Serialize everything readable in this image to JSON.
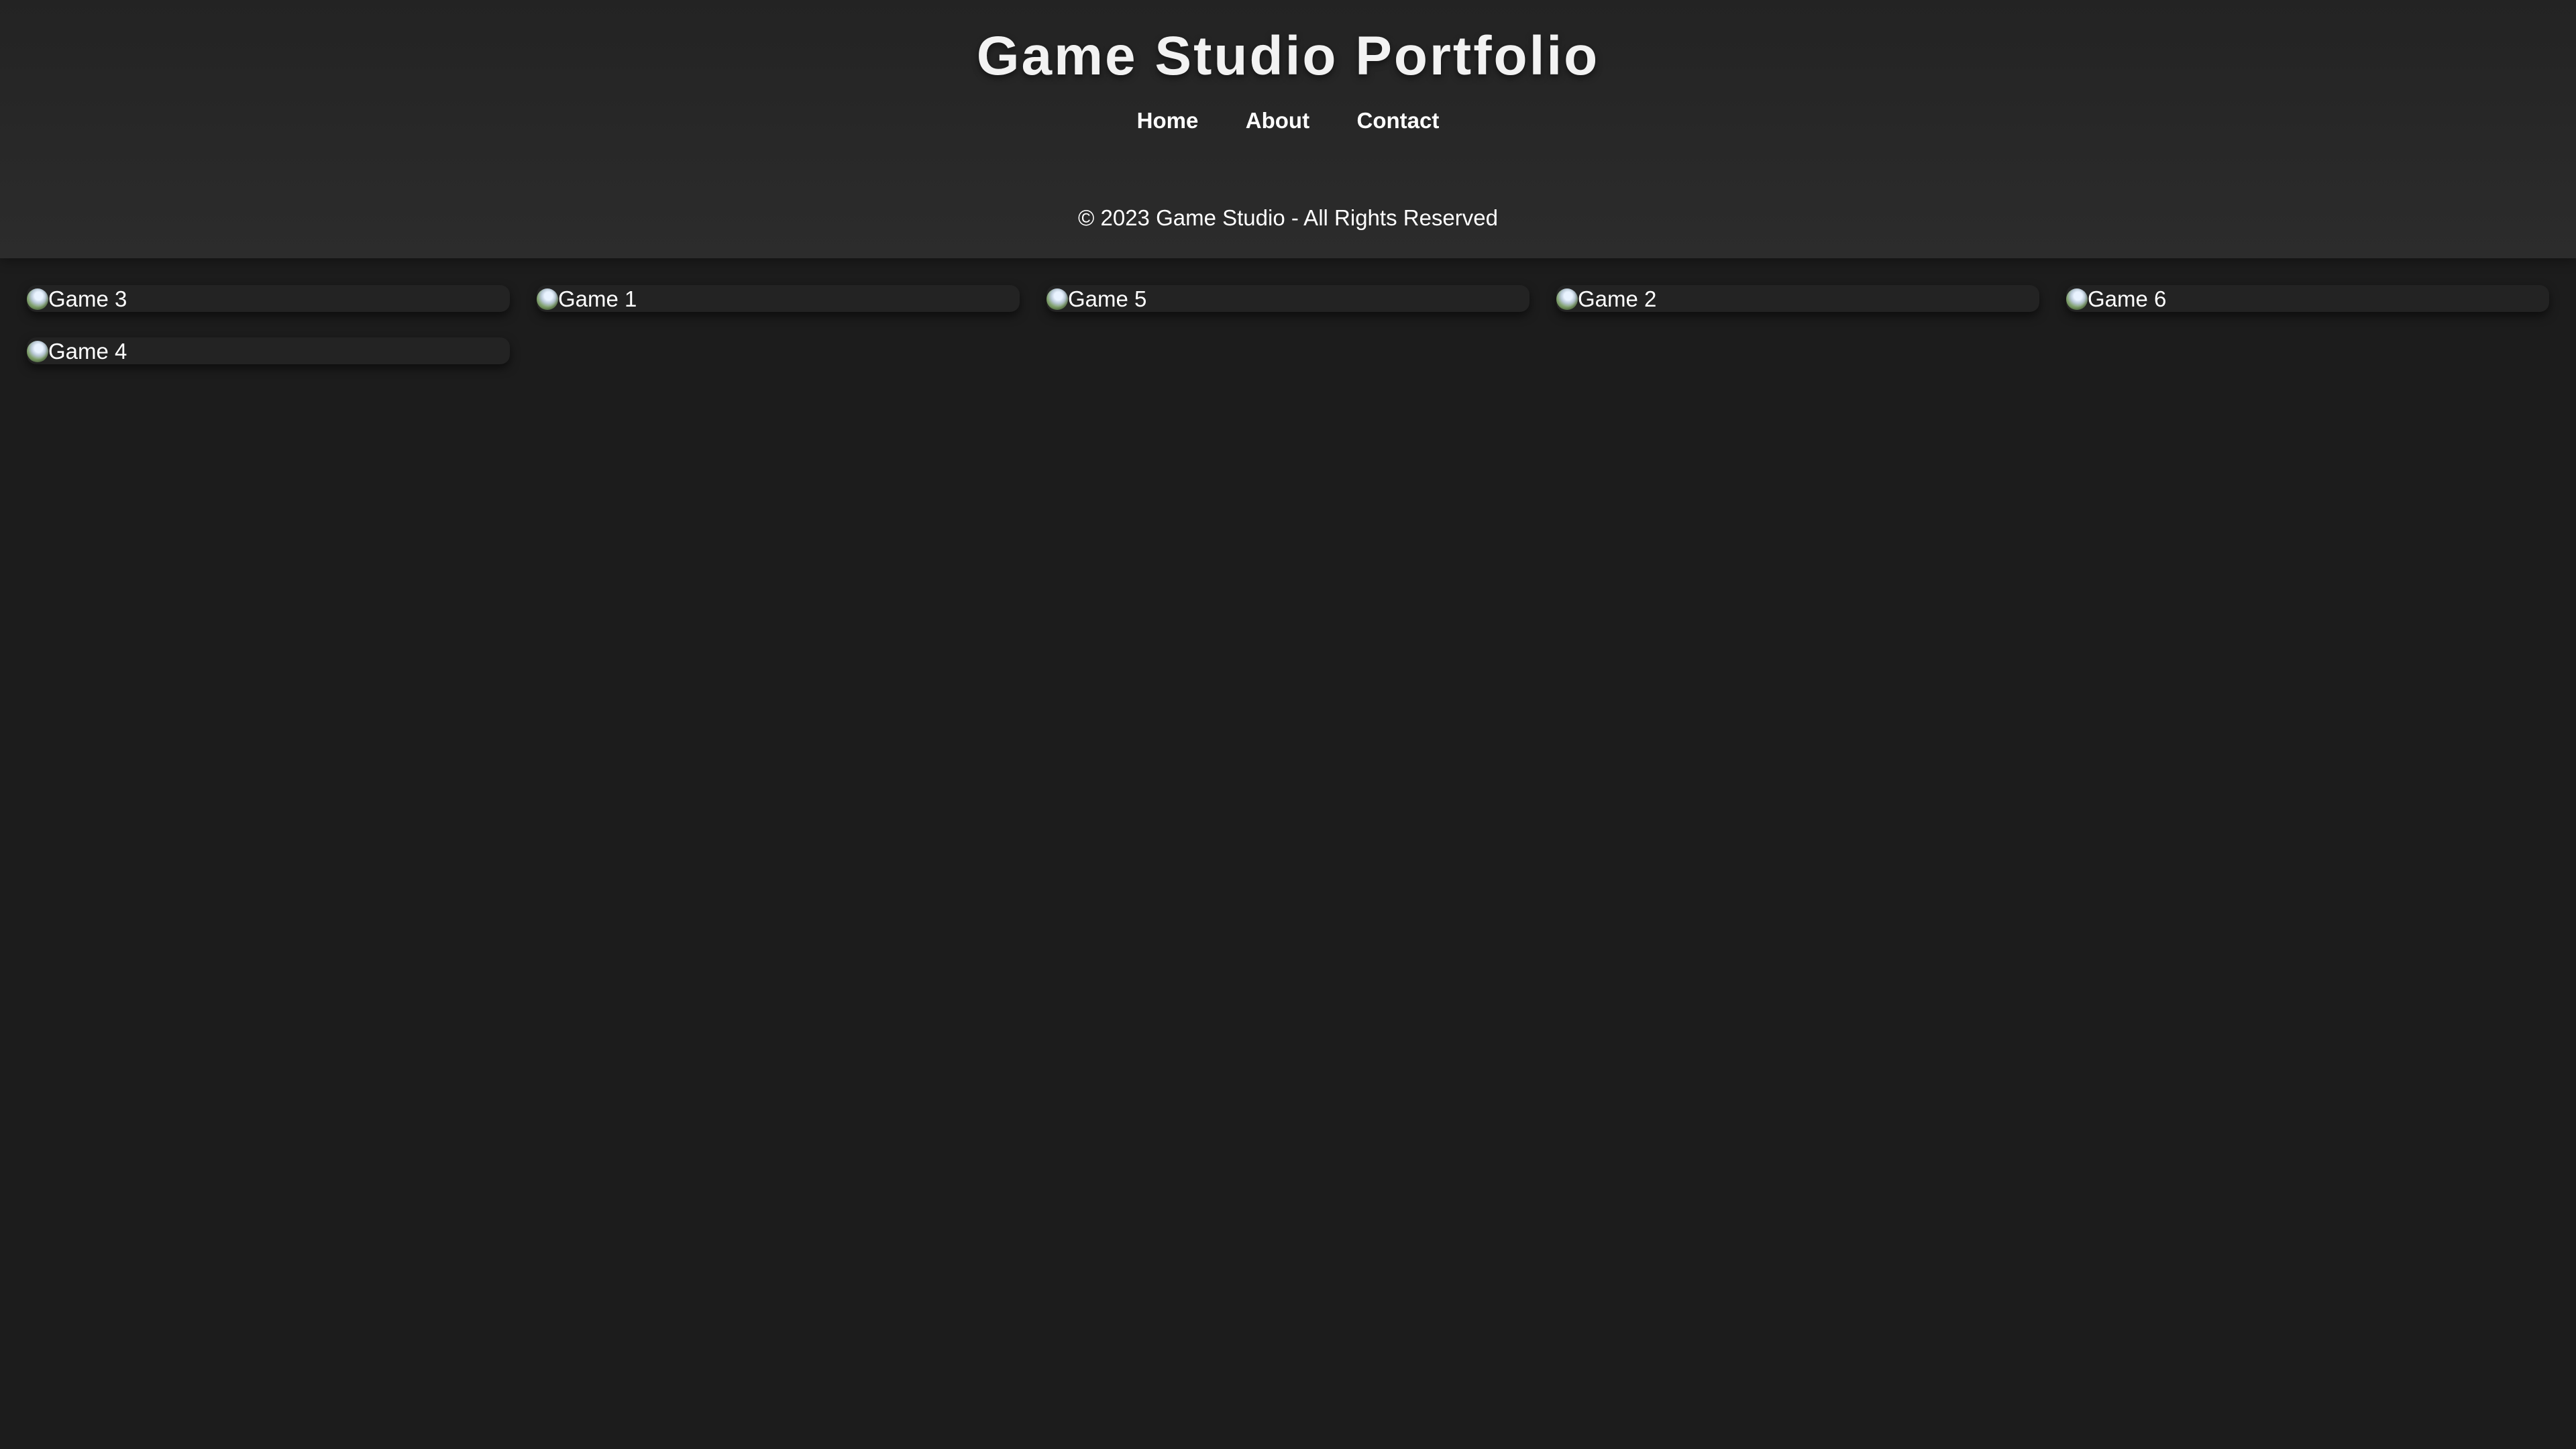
{
  "header": {
    "title": "Game Studio Portfolio",
    "nav": [
      {
        "label": "Home"
      },
      {
        "label": "About"
      },
      {
        "label": "Contact"
      }
    ],
    "copyright": "© 2023 Game Studio - All Rights Reserved"
  },
  "games": [
    {
      "alt": "Game 3",
      "icon": "broken-image-icon"
    },
    {
      "alt": "Game 1",
      "icon": "broken-image-icon"
    },
    {
      "alt": "Game 5",
      "icon": "broken-image-icon"
    },
    {
      "alt": "Game 2",
      "icon": "broken-image-icon"
    },
    {
      "alt": "Game 6",
      "icon": "broken-image-icon"
    },
    {
      "alt": "Game 4",
      "icon": "broken-image-icon"
    }
  ],
  "colors": {
    "background": "#1c1c1c",
    "header": "#2a2a2a",
    "card": "#232323",
    "text": "#ffffff"
  }
}
